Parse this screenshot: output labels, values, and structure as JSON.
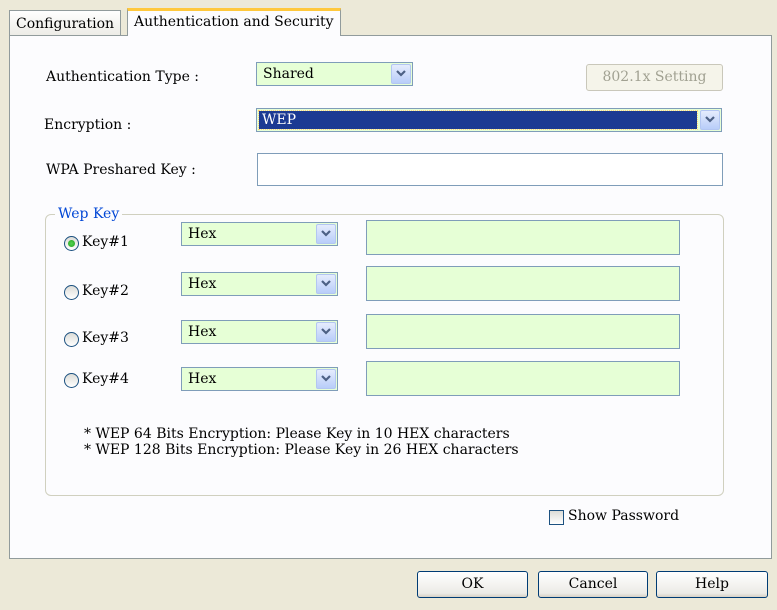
{
  "tabs": [
    {
      "label": "Configuration",
      "active": false
    },
    {
      "label": "Authentication and Security",
      "active": true
    }
  ],
  "auth": {
    "type_label": "Authentication Type :",
    "type_value": "Shared",
    "setting_button": "802.1x Setting",
    "encryption_label": "Encryption :",
    "encryption_value": "WEP",
    "wpa_label": "WPA Preshared Key :",
    "wpa_value": ""
  },
  "wep": {
    "legend": "Wep Key",
    "keys": [
      {
        "label": "Key#1",
        "format": "Hex",
        "value": "",
        "selected": true
      },
      {
        "label": "Key#2",
        "format": "Hex",
        "value": "",
        "selected": false
      },
      {
        "label": "Key#3",
        "format": "Hex",
        "value": "",
        "selected": false
      },
      {
        "label": "Key#4",
        "format": "Hex",
        "value": "",
        "selected": false
      }
    ],
    "notes": [
      "* WEP 64 Bits Encryption:   Please Key in 10 HEX characters",
      "* WEP 128 Bits Encryption:   Please Key in 26 HEX characters"
    ]
  },
  "show_password": {
    "label": "Show Password",
    "checked": false
  },
  "footer": {
    "ok": "OK",
    "cancel": "Cancel",
    "help": "Help"
  },
  "colors": {
    "accent_tab": "#FFC83C",
    "field_green": "#E6FFD6",
    "selection": "#1B3A93",
    "legend_blue": "#0046D5"
  },
  "icons": {
    "dropdown": "chevron-down-icon",
    "radio": "radio-icon",
    "checkbox": "checkbox-icon"
  }
}
